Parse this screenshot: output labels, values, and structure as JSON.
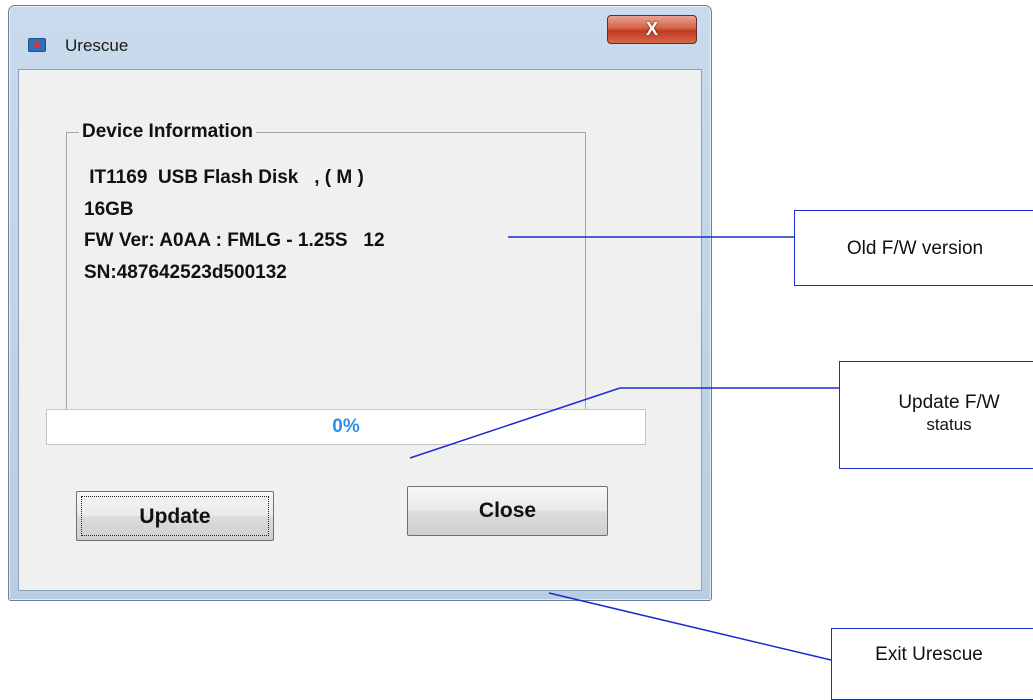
{
  "window": {
    "title": "Urescue",
    "close_glyph": "X"
  },
  "device_info": {
    "legend": "Device Information",
    "lines": [
      " IT1169  USB Flash Disk   , ( M )",
      "16GB",
      "FW Ver: A0AA : FMLG - 1.25S   12",
      "SN:487642523d500132"
    ]
  },
  "progress": {
    "percent": 0,
    "label": "0%"
  },
  "buttons": {
    "update_label": "Update",
    "close_label": "Close"
  },
  "annotations": {
    "old_fw": "Old F/W version",
    "status_line1": "Update F/W",
    "status_line2": "status",
    "exit": "Exit Urescue"
  },
  "colors": {
    "annotation_line": "#1a2ccf",
    "progress_text": "#2f8fe6",
    "close_button": "#c0391f"
  }
}
